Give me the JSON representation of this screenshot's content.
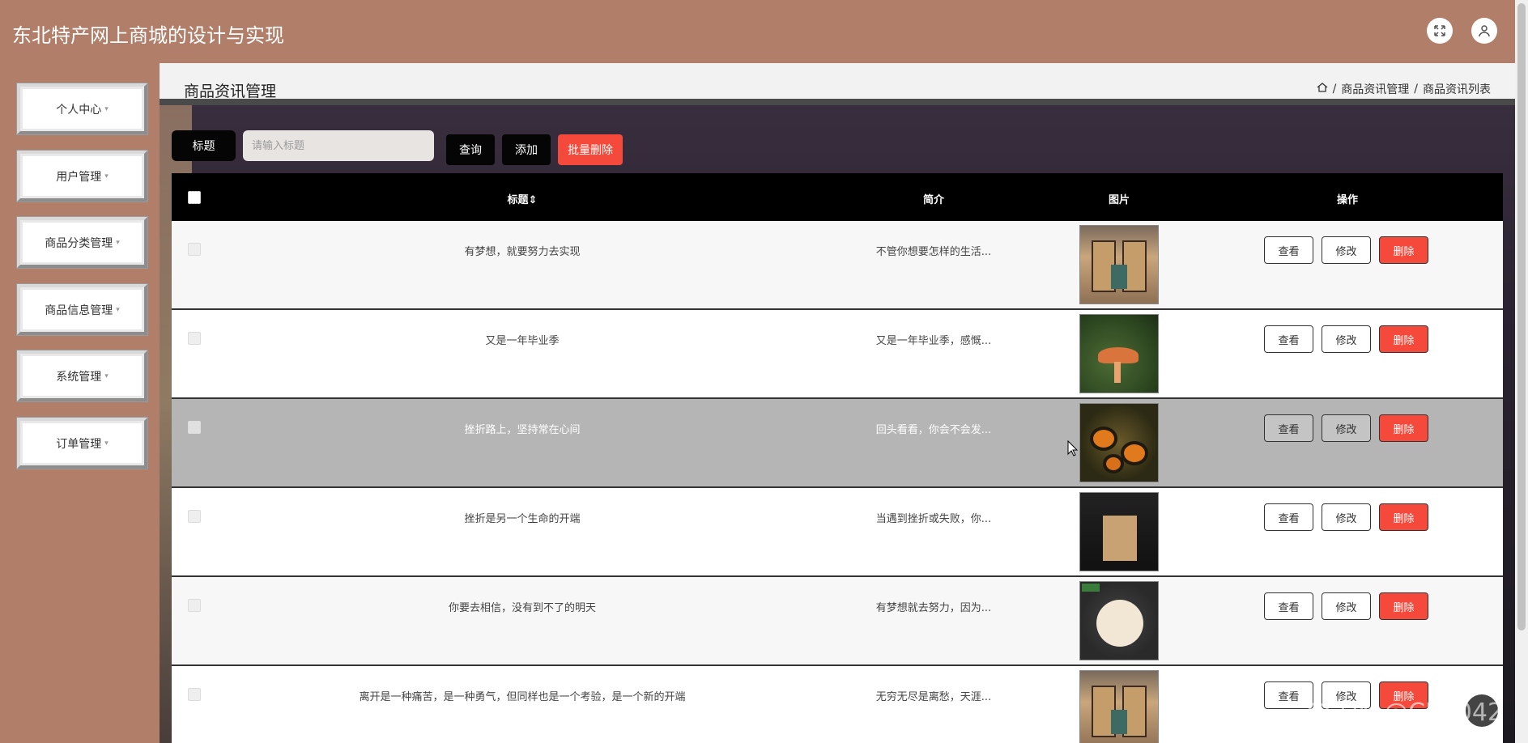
{
  "app": {
    "title": "东北特产网上商城的设计与实现"
  },
  "header": {
    "icons": [
      "fullscreen-icon",
      "user-icon"
    ]
  },
  "sidebar": {
    "items": [
      {
        "label": "个人中心"
      },
      {
        "label": "用户管理"
      },
      {
        "label": "商品分类管理"
      },
      {
        "label": "商品信息管理"
      },
      {
        "label": "系统管理"
      },
      {
        "label": "订单管理"
      }
    ]
  },
  "page": {
    "title": "商品资讯管理",
    "breadcrumb": [
      "商品资讯管理",
      "商品资讯列表"
    ]
  },
  "search": {
    "label": "标题",
    "placeholder": "请输入标题",
    "query_label": "查询",
    "add_label": "添加",
    "batch_delete_label": "批量删除"
  },
  "table": {
    "columns": [
      "标题",
      "简介",
      "图片",
      "操作"
    ],
    "actions": {
      "view": "查看",
      "edit": "修改",
      "delete": "删除"
    },
    "rows": [
      {
        "title": "有梦想，就要努力去实现",
        "intro": "不管你想要怎样的生活...",
        "image": "gift-box-image"
      },
      {
        "title": "又是一年毕业季",
        "intro": "又是一年毕业季，感慨...",
        "image": "mushroom-image"
      },
      {
        "title": "挫折路上，坚持常在心间",
        "intro": "回头看看，你会不会发...",
        "image": "fungus-image"
      },
      {
        "title": "挫折是另一个生命的开端",
        "intro": "当遇到挫折或失败，你...",
        "image": "gift-box-dark-image"
      },
      {
        "title": "你要去相信，没有到不了的明天",
        "intro": "有梦想就去努力，因为...",
        "image": "pear-image"
      },
      {
        "title": "离开是一种痛苦，是一种勇气，但同样也是一个考验，是一个新的开端",
        "intro": "无穷无尽是离愁，天涯...",
        "image": "gift-box-image"
      }
    ]
  },
  "watermark": "CSDN @CK3042",
  "colors": {
    "brand": "#b07e69",
    "danger": "#f5493b",
    "dark": "#050505"
  }
}
